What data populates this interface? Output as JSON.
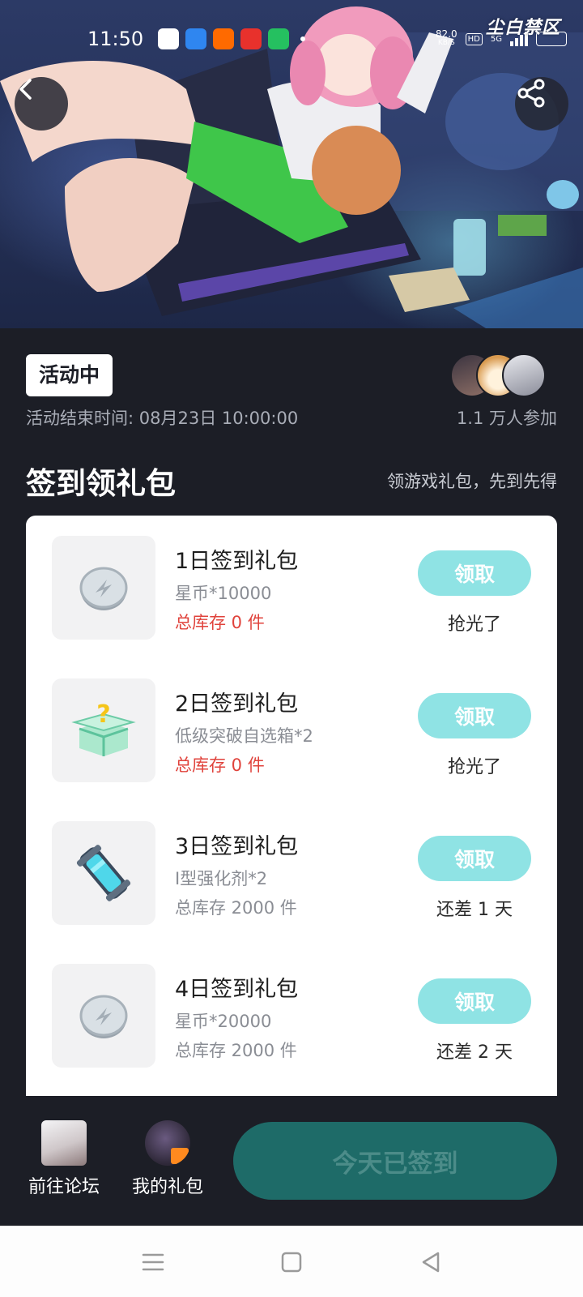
{
  "status_bar": {
    "time": "11:50",
    "speed_value": "82.0",
    "speed_unit": "KB/S",
    "hd_label": "HD",
    "network_label": "5G"
  },
  "hero": {
    "brand_logo": "尘白禁区",
    "back_icon": "chevron-left-icon",
    "share_icon": "share-icon"
  },
  "activity": {
    "status_tag": "活动中",
    "end_time": "活动结束时间: 08月23日 10:00:00",
    "participants": "1.1 万人参加"
  },
  "section": {
    "title": "签到领礼包",
    "subtitle": "领游戏礼包，先到先得"
  },
  "gifts": [
    {
      "name": "1日签到礼包",
      "desc": "星币*10000",
      "stock": "总库存 0 件",
      "button": "领取",
      "note": "抢光了",
      "icon": "star-coin-icon"
    },
    {
      "name": "2日签到礼包",
      "desc": "低级突破自选箱*2",
      "stock": "总库存 0 件",
      "button": "领取",
      "note": "抢光了",
      "icon": "mystery-box-icon"
    },
    {
      "name": "3日签到礼包",
      "desc": "I型强化剂*2",
      "stock": "总库存 2000 件",
      "button": "领取",
      "note": "还差 1 天",
      "icon": "enhancer-capsule-icon"
    },
    {
      "name": "4日签到礼包",
      "desc": "星币*20000",
      "stock": "总库存 2000 件",
      "button": "领取",
      "note": "还差 2 天",
      "icon": "star-coin-icon"
    }
  ],
  "bottom": {
    "forum_label": "前往论坛",
    "gifts_label": "我的礼包",
    "checkin_label": "今天已签到"
  },
  "colors": {
    "page_bg": "#1c1e26",
    "claim_button": "#8fe3e4",
    "checkin_button": "#1e6b68",
    "out_of_stock": "#e0433c"
  }
}
